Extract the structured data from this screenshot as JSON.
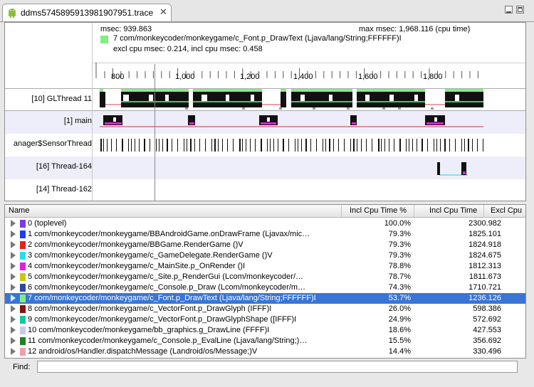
{
  "tab": {
    "title": "ddms5745895913981907951.trace",
    "close": "✕",
    "icon": "android-icon"
  },
  "header": {
    "msec_label": "msec: 939.863",
    "max_msec_label": "max msec: 1,968.116 (cpu time)",
    "method_label": "7 com/monkeycoder/monkeygame/c_Font.p_DrawText (Ljava/lang/String;FFFFFF)I",
    "cpu_label": "excl cpu msec: 0.214, incl cpu msec: 0.458",
    "swatch_color": "#80f080"
  },
  "axis": {
    "ticks": [
      "800",
      "1,000",
      "1,200",
      "1,400",
      "1,600",
      "1,800"
    ]
  },
  "threads": [
    {
      "label": "[10] GLThread 11"
    },
    {
      "label": "[1] main"
    },
    {
      "label": "anager$SensorThread"
    },
    {
      "label": "[16] Thread-164"
    },
    {
      "label": "[14] Thread-162"
    }
  ],
  "table": {
    "columns": [
      "Name",
      "Incl Cpu Time %",
      "Incl Cpu Time",
      "Excl Cpu"
    ],
    "rows": [
      {
        "name": "0 (toplevel)",
        "pct": "100.0%",
        "time": "2300.982",
        "color": "#7b3be0"
      },
      {
        "name": "1 com/monkeycoder/monkeygame/BBAndroidGame.onDrawFrame (Ljavax/mic…",
        "pct": "79.3%",
        "time": "1825.101",
        "color": "#1a3cf0"
      },
      {
        "name": "2 com/monkeycoder/monkeygame/BBGame.RenderGame ()V",
        "pct": "79.3%",
        "time": "1824.918",
        "color": "#e82020"
      },
      {
        "name": "3 com/monkeycoder/monkeygame/c_GameDelegate.RenderGame ()V",
        "pct": "79.3%",
        "time": "1824.675",
        "color": "#22e0e8"
      },
      {
        "name": "4 com/monkeycoder/monkeygame/c_MainSite.p_OnRender ()I",
        "pct": "78.8%",
        "time": "1812.313",
        "color": "#e020e0"
      },
      {
        "name": "5 com/monkeycoder/monkeygame/c_Site.p_RenderGui (Lcom/monkeycoder/…",
        "pct": "78.7%",
        "time": "1811.673",
        "color": "#c8c810"
      },
      {
        "name": "6 com/monkeycoder/monkeygame/c_Console.p_Draw (Lcom/monkeycoder/m…",
        "pct": "74.3%",
        "time": "1710.721",
        "color": "#2a4aa0"
      },
      {
        "name": "7 com/monkeycoder/monkeygame/c_Font.p_DrawText (Ljava/lang/String;FFFFFF)I",
        "pct": "53.7%",
        "time": "1236.126",
        "color": "#80f080",
        "selected": true
      },
      {
        "name": "8 com/monkeycoder/monkeygame/c_VectorFont.p_DrawGlyph (IFFF)I",
        "pct": "26.0%",
        "time": "598.386",
        "color": "#8a1010"
      },
      {
        "name": "9 com/monkeycoder/monkeygame/c_VectorFont.p_DrawGlyphShape ([IFFF)I",
        "pct": "24.9%",
        "time": "572.692",
        "color": "#10c8a0"
      },
      {
        "name": "10 com/monkeycoder/monkeygame/bb_graphics.g_DrawLine (FFFF)I",
        "pct": "18.6%",
        "time": "427.553",
        "color": "#c8c8f0"
      },
      {
        "name": "11 com/monkeycoder/monkeygame/c_Console.p_EvalLine (Ljava/lang/String;)…",
        "pct": "15.5%",
        "time": "356.692",
        "color": "#208020"
      },
      {
        "name": "12 android/os/Handler.dispatchMessage (Landroid/os/Message;)V",
        "pct": "14.4%",
        "time": "330.496",
        "color": "#f0a0a8"
      }
    ]
  },
  "find": {
    "label": "Find:",
    "value": ""
  }
}
